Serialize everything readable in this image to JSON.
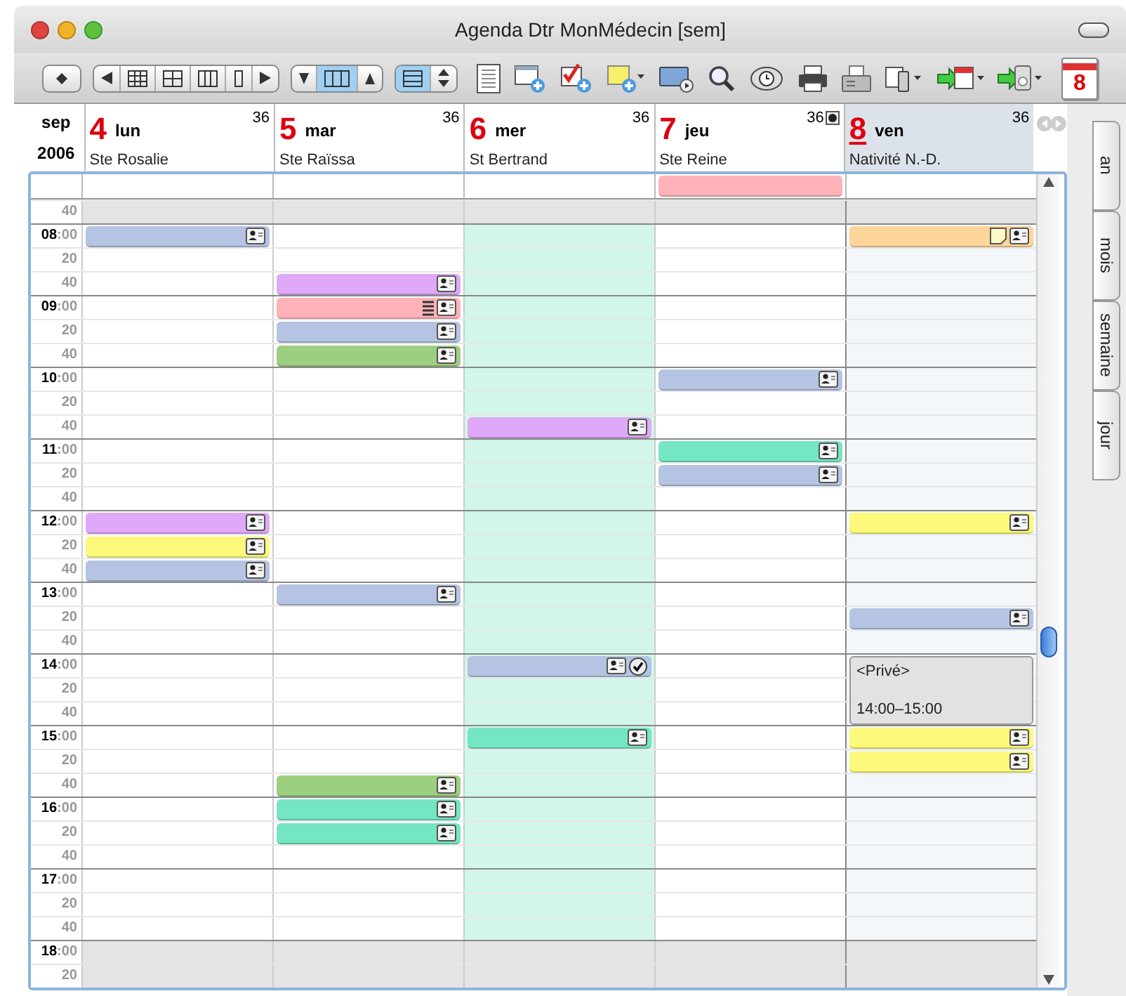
{
  "window": {
    "title": "Agenda Dtr MonMédecin [sem]"
  },
  "toolbar": {
    "calendar_day": "8"
  },
  "header": {
    "month": "sep",
    "year": "2006"
  },
  "days": [
    {
      "num": "4",
      "name": "lun",
      "saint": "Ste Rosalie",
      "week": "36",
      "selected": false,
      "today": false,
      "marker": false
    },
    {
      "num": "5",
      "name": "mar",
      "saint": "Ste Raïssa",
      "week": "36",
      "selected": false,
      "today": false,
      "marker": false
    },
    {
      "num": "6",
      "name": "mer",
      "saint": "St Bertrand",
      "week": "36",
      "selected": false,
      "today": true,
      "marker": false
    },
    {
      "num": "7",
      "name": "jeu",
      "saint": "Ste Reine",
      "week": "36",
      "selected": false,
      "today": false,
      "marker": true,
      "all_day": {
        "color": "#ffb3b9"
      }
    },
    {
      "num": "8",
      "name": "ven",
      "saint": "Nativité N.-D.",
      "week": "36",
      "selected": true,
      "today": false,
      "marker": false
    }
  ],
  "rows": [
    {
      "minute": "40",
      "off": true,
      "cells": [
        {},
        {},
        {},
        {},
        {}
      ]
    },
    {
      "hour": "08",
      "minute": ":00",
      "off": false,
      "cells": [
        {
          "color": "#b4c4e2",
          "icons": [
            {
              "kind": "contact"
            }
          ]
        },
        {},
        {},
        {},
        {
          "color": "#fed59a",
          "icons": [
            {
              "kind": "note"
            },
            {
              "kind": "contact"
            }
          ]
        }
      ]
    },
    {
      "minute": "20",
      "off": false,
      "cells": [
        {},
        {},
        {},
        {},
        {}
      ]
    },
    {
      "minute": "40",
      "off": false,
      "cells": [
        {},
        {
          "color": "#e0a8f8",
          "icons": [
            {
              "kind": "contact"
            }
          ]
        },
        {},
        {},
        {}
      ]
    },
    {
      "hour": "09",
      "minute": ":00",
      "off": false,
      "cells": [
        {},
        {
          "color": "#ffb3b9",
          "icons": [
            {
              "kind": "list"
            },
            {
              "kind": "contact"
            }
          ]
        },
        {},
        {},
        {}
      ]
    },
    {
      "minute": "20",
      "off": false,
      "cells": [
        {},
        {
          "color": "#b4c4e2",
          "icons": [
            {
              "kind": "contact"
            }
          ]
        },
        {},
        {},
        {}
      ]
    },
    {
      "minute": "40",
      "off": false,
      "cells": [
        {},
        {
          "color": "#9dcf80",
          "icons": [
            {
              "kind": "contact"
            }
          ]
        },
        {},
        {},
        {}
      ]
    },
    {
      "hour": "10",
      "minute": ":00",
      "off": false,
      "cells": [
        {},
        {},
        {},
        {
          "color": "#b4c4e2",
          "icons": [
            {
              "kind": "contact"
            }
          ]
        },
        {}
      ]
    },
    {
      "minute": "20",
      "off": false,
      "cells": [
        {},
        {},
        {},
        {},
        {}
      ]
    },
    {
      "minute": "40",
      "off": false,
      "cells": [
        {},
        {},
        {
          "color": "#e0a8f8",
          "icons": [
            {
              "kind": "contact"
            }
          ]
        },
        {},
        {}
      ]
    },
    {
      "hour": "11",
      "minute": ":00",
      "off": false,
      "cells": [
        {},
        {},
        {},
        {
          "color": "#74e6c4",
          "icons": [
            {
              "kind": "contact"
            }
          ]
        },
        {}
      ]
    },
    {
      "minute": "20",
      "off": false,
      "cells": [
        {},
        {},
        {},
        {
          "color": "#b4c4e2",
          "icons": [
            {
              "kind": "contact"
            }
          ]
        },
        {}
      ]
    },
    {
      "minute": "40",
      "off": false,
      "cells": [
        {},
        {},
        {},
        {},
        {}
      ]
    },
    {
      "hour": "12",
      "minute": ":00",
      "off": false,
      "cells": [
        {
          "color": "#e0a8f8",
          "icons": [
            {
              "kind": "contact"
            }
          ]
        },
        {},
        {},
        {},
        {
          "color": "#fdf97a",
          "icons": [
            {
              "kind": "contact"
            }
          ]
        }
      ]
    },
    {
      "minute": "20",
      "off": false,
      "cells": [
        {
          "color": "#fdf97a",
          "icons": [
            {
              "kind": "contact"
            }
          ]
        },
        {},
        {},
        {},
        {}
      ]
    },
    {
      "minute": "40",
      "off": false,
      "cells": [
        {
          "color": "#b4c4e2",
          "icons": [
            {
              "kind": "contact"
            }
          ]
        },
        {},
        {},
        {},
        {}
      ]
    },
    {
      "hour": "13",
      "minute": ":00",
      "off": false,
      "cells": [
        {},
        {
          "color": "#b4c4e2",
          "icons": [
            {
              "kind": "contact"
            }
          ]
        },
        {},
        {},
        {}
      ]
    },
    {
      "minute": "20",
      "off": false,
      "cells": [
        {},
        {},
        {},
        {},
        {
          "color": "#b4c4e2",
          "icons": [
            {
              "kind": "contact"
            }
          ]
        }
      ]
    },
    {
      "minute": "40",
      "off": false,
      "cells": [
        {},
        {},
        {},
        {},
        {}
      ]
    },
    {
      "hour": "14",
      "minute": ":00",
      "off": false,
      "cells": [
        {},
        {},
        {
          "color": "#b4c4e2",
          "icons": [
            {
              "kind": "contact"
            },
            {
              "kind": "check"
            }
          ]
        },
        {},
        {
          "kind": "private",
          "color": "#e2e2e2",
          "title": "<Privé>",
          "time": "14:00–15:00"
        }
      ]
    },
    {
      "minute": "20",
      "off": false,
      "cells": [
        {},
        {},
        {},
        {},
        {}
      ]
    },
    {
      "minute": "40",
      "off": false,
      "cells": [
        {},
        {},
        {},
        {},
        {}
      ]
    },
    {
      "hour": "15",
      "minute": ":00",
      "off": false,
      "cells": [
        {},
        {},
        {
          "color": "#74e6c4",
          "icons": [
            {
              "kind": "contact"
            }
          ]
        },
        {},
        {
          "color": "#fdf97a",
          "icons": [
            {
              "kind": "contact"
            }
          ]
        }
      ]
    },
    {
      "minute": "20",
      "off": false,
      "cells": [
        {},
        {},
        {},
        {},
        {
          "color": "#fdf97a",
          "icons": [
            {
              "kind": "contact"
            }
          ]
        }
      ]
    },
    {
      "minute": "40",
      "off": false,
      "cells": [
        {},
        {
          "color": "#9dcf80",
          "icons": [
            {
              "kind": "contact"
            }
          ]
        },
        {},
        {},
        {}
      ]
    },
    {
      "hour": "16",
      "minute": ":00",
      "off": false,
      "cells": [
        {},
        {
          "color": "#74e6c4",
          "icons": [
            {
              "kind": "contact"
            }
          ]
        },
        {},
        {},
        {}
      ]
    },
    {
      "minute": "20",
      "off": false,
      "cells": [
        {},
        {
          "color": "#74e6c4",
          "icons": [
            {
              "kind": "contact"
            }
          ]
        },
        {},
        {},
        {}
      ]
    },
    {
      "minute": "40",
      "off": false,
      "cells": [
        {},
        {},
        {},
        {},
        {}
      ]
    },
    {
      "hour": "17",
      "minute": ":00",
      "off": false,
      "cells": [
        {},
        {},
        {},
        {},
        {}
      ]
    },
    {
      "minute": "20",
      "off": false,
      "cells": [
        {},
        {},
        {},
        {},
        {}
      ]
    },
    {
      "minute": "40",
      "off": false,
      "cells": [
        {},
        {},
        {},
        {},
        {}
      ]
    },
    {
      "hour": "18",
      "minute": ":00",
      "off": true,
      "cells": [
        {},
        {},
        {},
        {},
        {}
      ]
    },
    {
      "minute": "20",
      "off": true,
      "cells": [
        {},
        {},
        {},
        {},
        {}
      ]
    }
  ],
  "side_tabs": [
    {
      "label": "an"
    },
    {
      "label": "mois"
    },
    {
      "label": "semaine"
    },
    {
      "label": "jour"
    }
  ]
}
